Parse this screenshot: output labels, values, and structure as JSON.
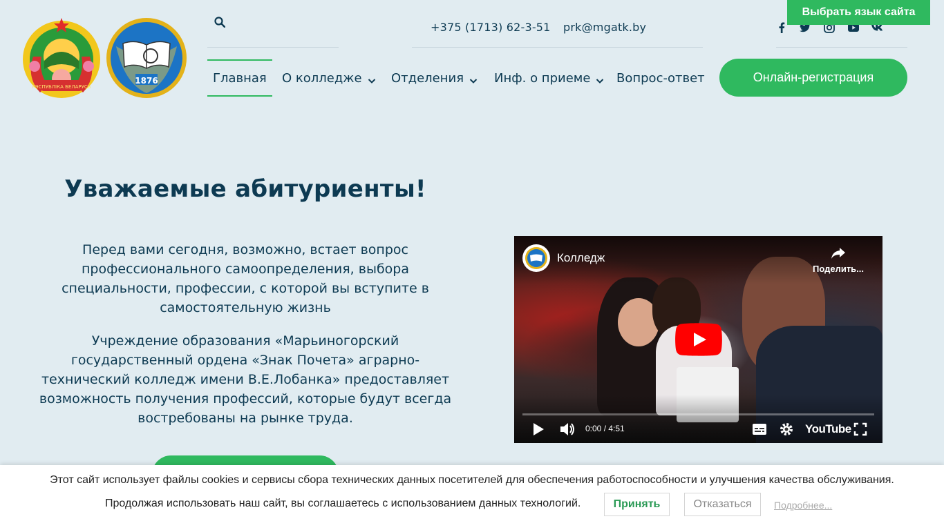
{
  "header": {
    "contacts": {
      "phone": "+375 (1713) 62-3-51",
      "email": "prk@mgatk.by"
    },
    "lang_button": "Выбрать язык сайта",
    "search_icon": "search-icon",
    "social": [
      "facebook-icon",
      "twitter-icon",
      "instagram-icon",
      "youtube-icon",
      "vk-icon"
    ],
    "emblem_text": "РЭСПУБЛІКА БЕЛАРУСЬ",
    "seal_year": "1876"
  },
  "nav": {
    "items": [
      {
        "label": "Главная",
        "active": true
      },
      {
        "label": "О колледже",
        "dropdown": true
      },
      {
        "label": "Отделения",
        "dropdown": true
      },
      {
        "label": "Инф. о приеме",
        "dropdown": true
      },
      {
        "label": "Вопрос-ответ"
      }
    ],
    "register_button": "Онлайн-регистрация"
  },
  "main": {
    "title": "Уважаемые абитуриенты!",
    "paragraph1": "Перед вами сегодня, возможно, встает вопрос профессионального самоопределения, выбора специальности, профессии, с которой вы вступите в самостоятельную жизнь",
    "paragraph2": "Учреждение образования «Марьиногорский государственный ордена «Знак Почета» аграрно-технический колледж имени В.Е.Лобанка» предоставляет возможность получения профессий, которые будут всегда востребованы на рынке труда."
  },
  "video": {
    "title": "Колледж",
    "share_label": "Поделить...",
    "time": "0:00 / 4:51",
    "brand": "YouTube"
  },
  "cookie": {
    "line1": "Этот сайт использует файлы cookies и сервисы сбора технических данных посетителей для обеспечения работоспособности и улучшения качества обслуживания.",
    "line2": "Продолжая использовать наш сайт, вы соглашаетесь с использованием данных технологий.",
    "accept": "Принять",
    "decline": "Отказаться",
    "more": "Подробнее..."
  },
  "colors": {
    "accent": "#2fb95f",
    "text": "#0d3a52",
    "background": "#e1ecf1"
  }
}
